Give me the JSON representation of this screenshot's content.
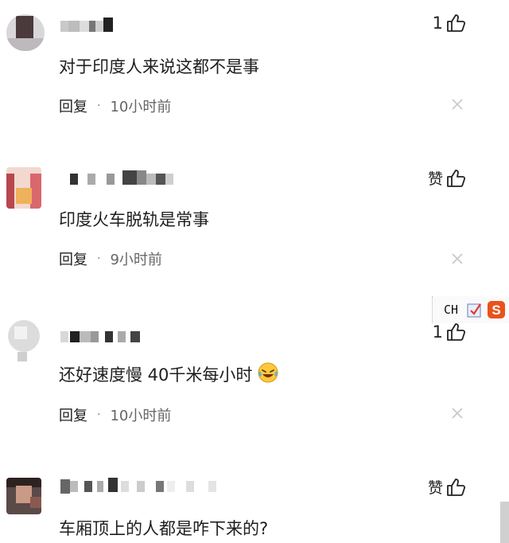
{
  "comments": [
    {
      "text": "对于印度人来说这都不是事",
      "likes": "1",
      "reply": "回复",
      "dot": "·",
      "time": "10小时前"
    },
    {
      "text": "印度火车脱轨是常事",
      "likes": "赞",
      "reply": "回复",
      "dot": "·",
      "time": "9小时前"
    },
    {
      "text": "还好速度慢 40千米每小时",
      "likes": "1",
      "reply": "回复",
      "dot": "·",
      "time": "10小时前"
    },
    {
      "text": "车厢顶上的人都是咋下来的?",
      "likes": "赞"
    }
  ],
  "ime": {
    "label": "CH"
  },
  "icons": [
    "thumbs-up-icon",
    "close-icon",
    "laughing-crying-emoji",
    "ime-check-icon",
    "sogou-s-icon"
  ],
  "colors": {
    "accent_orange": "#e8531b",
    "text": "#1e1e1e",
    "meta": "#666666"
  }
}
